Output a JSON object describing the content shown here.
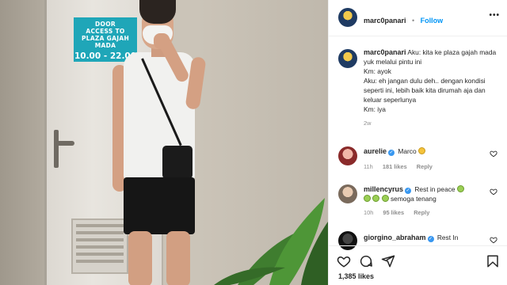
{
  "sign": {
    "line1": "DOOR",
    "line2": "ACCESS TO",
    "line3": "PLAZA GAJAH MADA",
    "line4": "10.00 - 22.00"
  },
  "post": {
    "username": "marc0panari",
    "follow_label": "Follow",
    "more_label": "•••",
    "caption_user": "marc0panari",
    "caption_text": "Aku: kita ke plaza gajah mada yuk melalui pintu ini\nKm: ayok\nAku: eh jangan dulu deh.. dengan kondisi seperti ini, lebih baik kita dirumah aja dan keluar seperlunya\nKm: iya",
    "caption_age": "2w",
    "likes_text": "1,385 likes"
  },
  "comments": [
    {
      "user": "aurelie",
      "text": "Marco",
      "age": "11h",
      "likes": "181 likes",
      "reply": "Reply"
    },
    {
      "user": "millencyrus",
      "text": "Rest in peace",
      "text2": "semoga tenang",
      "age": "10h",
      "likes": "95 likes",
      "reply": "Reply"
    },
    {
      "user": "giorgino_abraham",
      "text": "Rest In"
    }
  ],
  "icons": {
    "heart": "heart-icon",
    "comment": "comment-icon",
    "share": "share-icon",
    "bookmark": "bookmark-icon"
  },
  "colors": {
    "link_blue": "#0095f6",
    "sign_teal": "#1fa6b8",
    "muted": "#8e8e8e"
  }
}
